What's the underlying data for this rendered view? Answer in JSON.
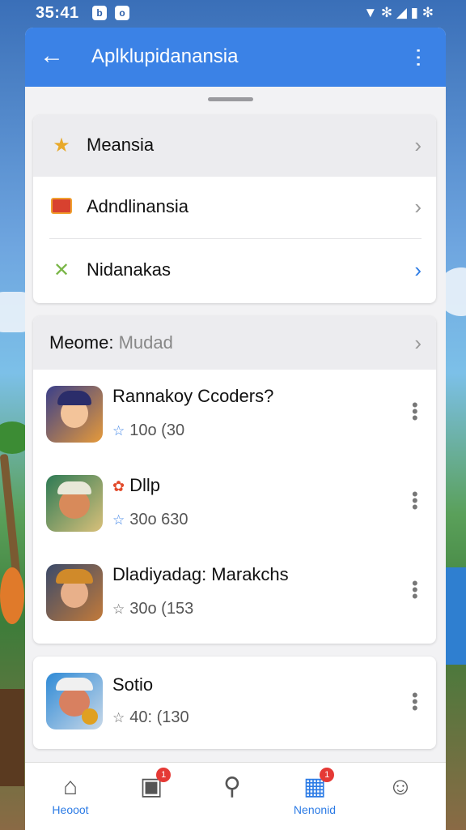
{
  "status_bar": {
    "time": "35:41",
    "notif1": "b",
    "notif2": "o",
    "right_icons": "▼ ✻ ◢ ▮ ✻"
  },
  "app_bar": {
    "title": "Aplklupidanansia",
    "back_icon": "arrow-left-icon",
    "menu_icon": "more-vert-icon"
  },
  "menu_card": {
    "items": [
      {
        "label": "Meansia",
        "icon": "star-icon"
      },
      {
        "label": "Adndlinansia",
        "icon": "wallet-icon"
      },
      {
        "label": "Nidanakas",
        "icon": "butterfly-icon"
      }
    ]
  },
  "apps_section": {
    "header_bold": "Meome:",
    "header_light": "Mudad",
    "apps": [
      {
        "name": "Rannakoy Ccoders?",
        "rating": "10o (30"
      },
      {
        "name": "Dllp",
        "rating": "30o 630"
      },
      {
        "name": "Dladiyadag: Marakchs",
        "rating": "30o (153"
      }
    ]
  },
  "single_app": {
    "name": "Sotio",
    "rating": "40: (130"
  },
  "bottom_nav": {
    "items": [
      {
        "label": "Heooot",
        "icon": "home-icon"
      },
      {
        "label": "",
        "icon": "bag-icon",
        "badge": "1"
      },
      {
        "label": "",
        "icon": "search-icon"
      },
      {
        "label": "Nenonid",
        "icon": "apps-icon",
        "badge": "1"
      },
      {
        "label": "",
        "icon": "profile-icon"
      }
    ]
  },
  "colors": {
    "accent": "#3b82e6",
    "badge": "#e53935"
  }
}
